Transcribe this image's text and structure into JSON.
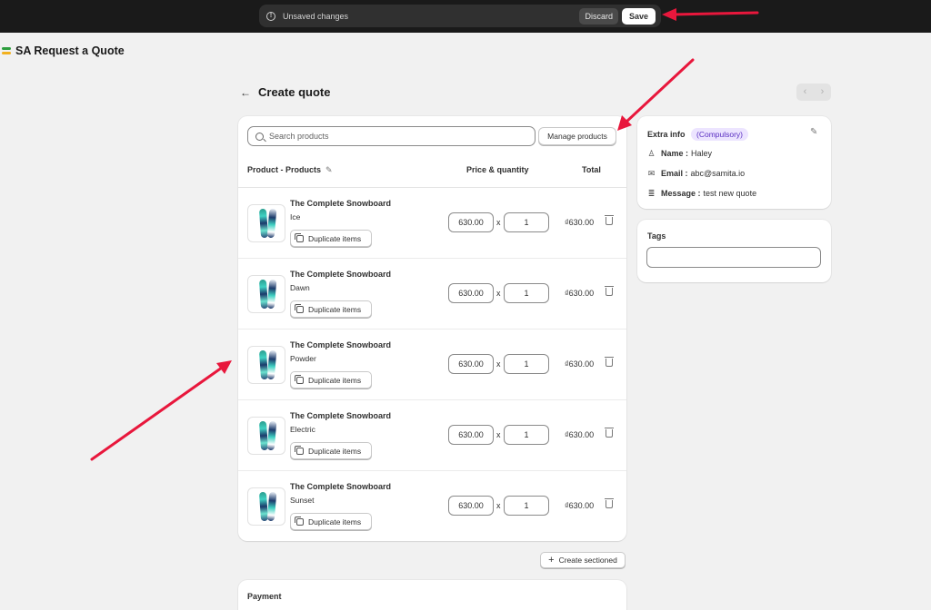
{
  "savebar": {
    "message": "Unsaved changes",
    "discard": "Discard",
    "save": "Save"
  },
  "app": {
    "title": "SA Request a Quote"
  },
  "page": {
    "back": "←",
    "title": "Create quote",
    "prev": "‹",
    "next": "›"
  },
  "search": {
    "placeholder": "Search products",
    "manage": "Manage products"
  },
  "table": {
    "col_product": "Product - Products",
    "col_price": "Price & quantity",
    "col_total": "Total",
    "rows": [
      {
        "name": "The Complete Snowboard",
        "variant": "Ice",
        "dup": "Duplicate items",
        "price": "630.00",
        "x": "x",
        "qty": "1",
        "total": "₫630.00"
      },
      {
        "name": "The Complete Snowboard",
        "variant": "Dawn",
        "dup": "Duplicate items",
        "price": "630.00",
        "x": "x",
        "qty": "1",
        "total": "₫630.00"
      },
      {
        "name": "The Complete Snowboard",
        "variant": "Powder",
        "dup": "Duplicate items",
        "price": "630.00",
        "x": "x",
        "qty": "1",
        "total": "₫630.00"
      },
      {
        "name": "The Complete Snowboard",
        "variant": "Electric",
        "dup": "Duplicate items",
        "price": "630.00",
        "x": "x",
        "qty": "1",
        "total": "₫630.00"
      },
      {
        "name": "The Complete Snowboard",
        "variant": "Sunset",
        "dup": "Duplicate items",
        "price": "630.00",
        "x": "x",
        "qty": "1",
        "total": "₫630.00"
      }
    ]
  },
  "create_section": "Create sectioned",
  "payment": {
    "label": "Payment"
  },
  "extra": {
    "title": "Extra info",
    "badge": "(Compulsory)",
    "name_key": "Name :",
    "name_val": "Haley",
    "email_key": "Email :",
    "email_val": "abc@samita.io",
    "message_key": "Message :",
    "message_val": "test new quote"
  },
  "tags": {
    "title": "Tags",
    "value": ""
  },
  "colors": {
    "accent_arrow": "#e8173c",
    "badge_bg": "#ece4ff",
    "badge_fg": "#5a2fc2"
  }
}
